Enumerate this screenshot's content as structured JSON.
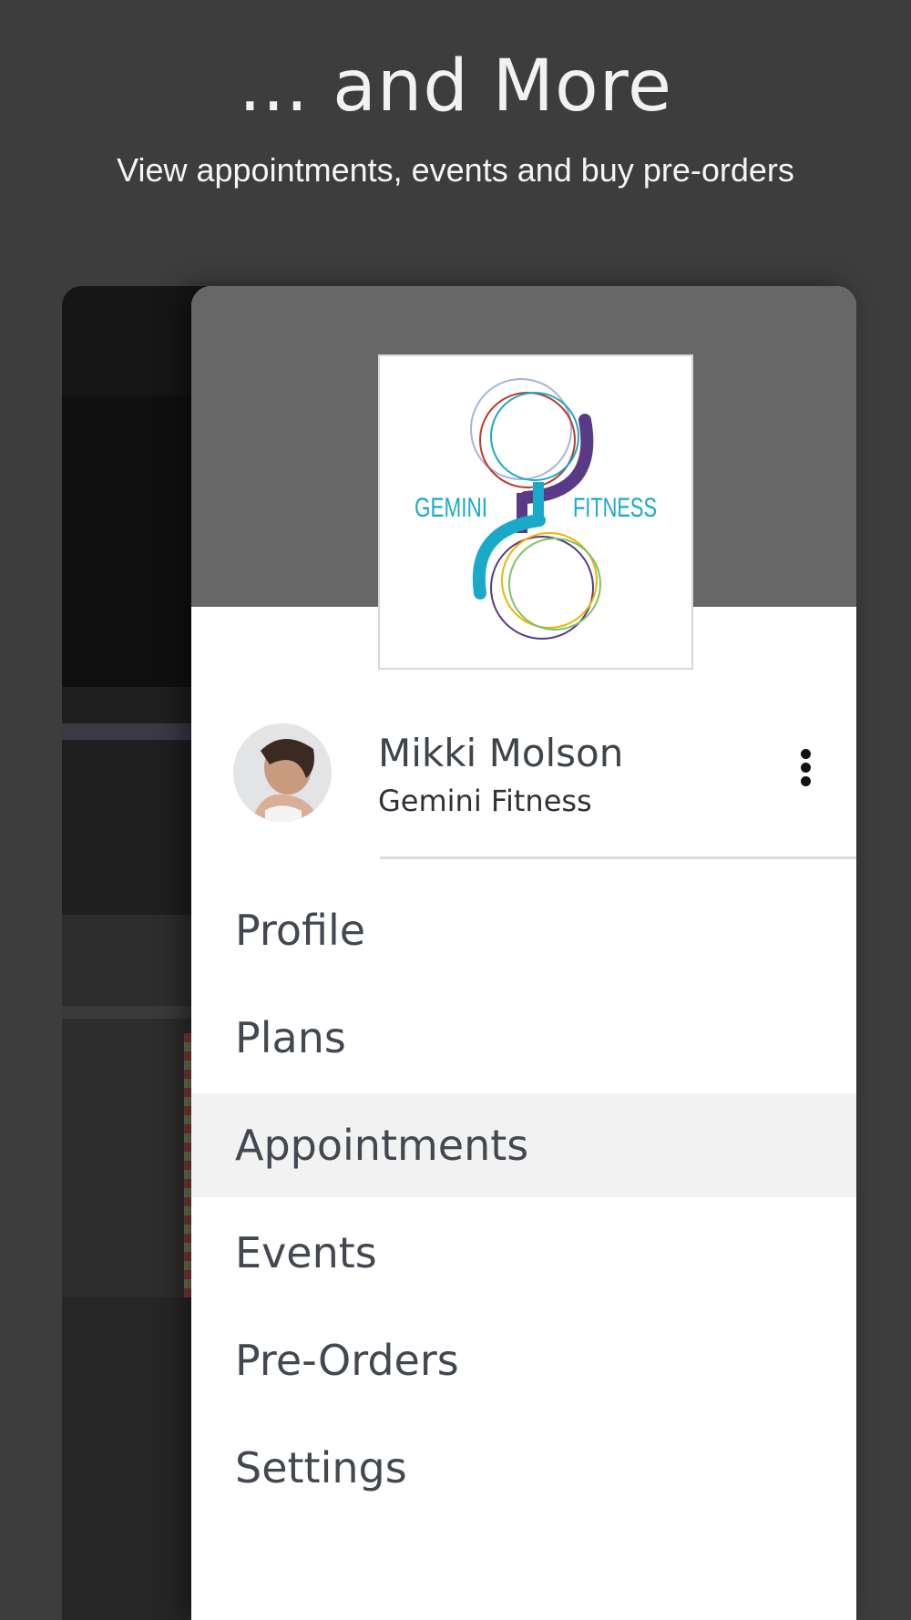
{
  "headline": "... and More",
  "subline": "View appointments, events and buy pre-orders",
  "logo": {
    "text_left": "GEMINI",
    "text_right": "FITNESS"
  },
  "user": {
    "name": "Mikki Molson",
    "organization": "Gemini Fitness"
  },
  "menu": {
    "items": [
      {
        "label": "Profile",
        "active": false
      },
      {
        "label": "Plans",
        "active": false
      },
      {
        "label": "Appointments",
        "active": true
      },
      {
        "label": "Events",
        "active": false
      },
      {
        "label": "Pre-Orders",
        "active": false
      },
      {
        "label": "Settings",
        "active": false
      }
    ]
  },
  "colors": {
    "background": "#3d3d3d",
    "drawer_header": "#676767",
    "active_item": "#f2f2f2",
    "logo_teal": "#1aa9c8",
    "logo_purple": "#5a3a86"
  }
}
